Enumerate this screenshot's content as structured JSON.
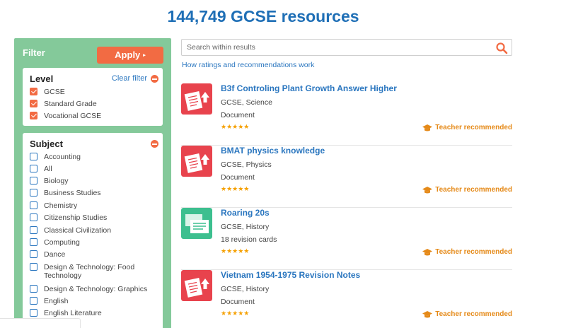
{
  "page_title": "144,749 GCSE resources",
  "filter": {
    "title": "Filter",
    "apply_label": "Apply",
    "level": {
      "title": "Level",
      "clear_label": "Clear filter",
      "options": [
        {
          "label": "GCSE",
          "checked": true
        },
        {
          "label": "Standard Grade",
          "checked": true
        },
        {
          "label": "Vocational GCSE",
          "checked": true
        }
      ]
    },
    "subject": {
      "title": "Subject",
      "options": [
        {
          "label": "Accounting",
          "checked": false
        },
        {
          "label": "All",
          "checked": false
        },
        {
          "label": "Biology",
          "checked": false
        },
        {
          "label": "Business Studies",
          "checked": false
        },
        {
          "label": "Chemistry",
          "checked": false
        },
        {
          "label": "Citizenship Studies",
          "checked": false
        },
        {
          "label": "Classical Civilization",
          "checked": false
        },
        {
          "label": "Computing",
          "checked": false
        },
        {
          "label": "Dance",
          "checked": false
        },
        {
          "label": "Design & Technology: Food Technology",
          "checked": false
        },
        {
          "label": "Design & Technology: Graphics",
          "checked": false
        },
        {
          "label": "English",
          "checked": false
        },
        {
          "label": "English Literature",
          "checked": false
        }
      ]
    }
  },
  "search": {
    "placeholder": "Search within results"
  },
  "ratings_link": "How ratings and recommendations work",
  "results": [
    {
      "title": "B3f Controling Plant Growth Answer Higher",
      "meta": "GCSE, Science",
      "type": "Document",
      "stars": "★★★★★",
      "badge": "Teacher recommended",
      "icon": "document-icon",
      "icon_color": "#e8434d"
    },
    {
      "title": "BMAT physics knowledge",
      "meta": "GCSE, Physics",
      "type": "Document",
      "stars": "★★★★★",
      "badge": "Teacher recommended",
      "icon": "document-icon",
      "icon_color": "#e8434d"
    },
    {
      "title": "Roaring 20s",
      "meta": "GCSE, History",
      "type": "18 revision cards",
      "stars": "★★★★★",
      "badge": "Teacher recommended",
      "icon": "revision-cards-icon",
      "icon_color": "#3dbf8f"
    },
    {
      "title": "Vietnam 1954-1975 Revision Notes",
      "meta": "GCSE, History",
      "type": "Document",
      "stars": "★★★★★",
      "badge": "Teacher recommended",
      "icon": "document-icon",
      "icon_color": "#e8434d"
    }
  ],
  "colors": {
    "accent": "#f26b43",
    "link": "#2a76bf",
    "filter_bg": "#84c99a",
    "badge": "#e58a19",
    "star": "#f5a000"
  }
}
